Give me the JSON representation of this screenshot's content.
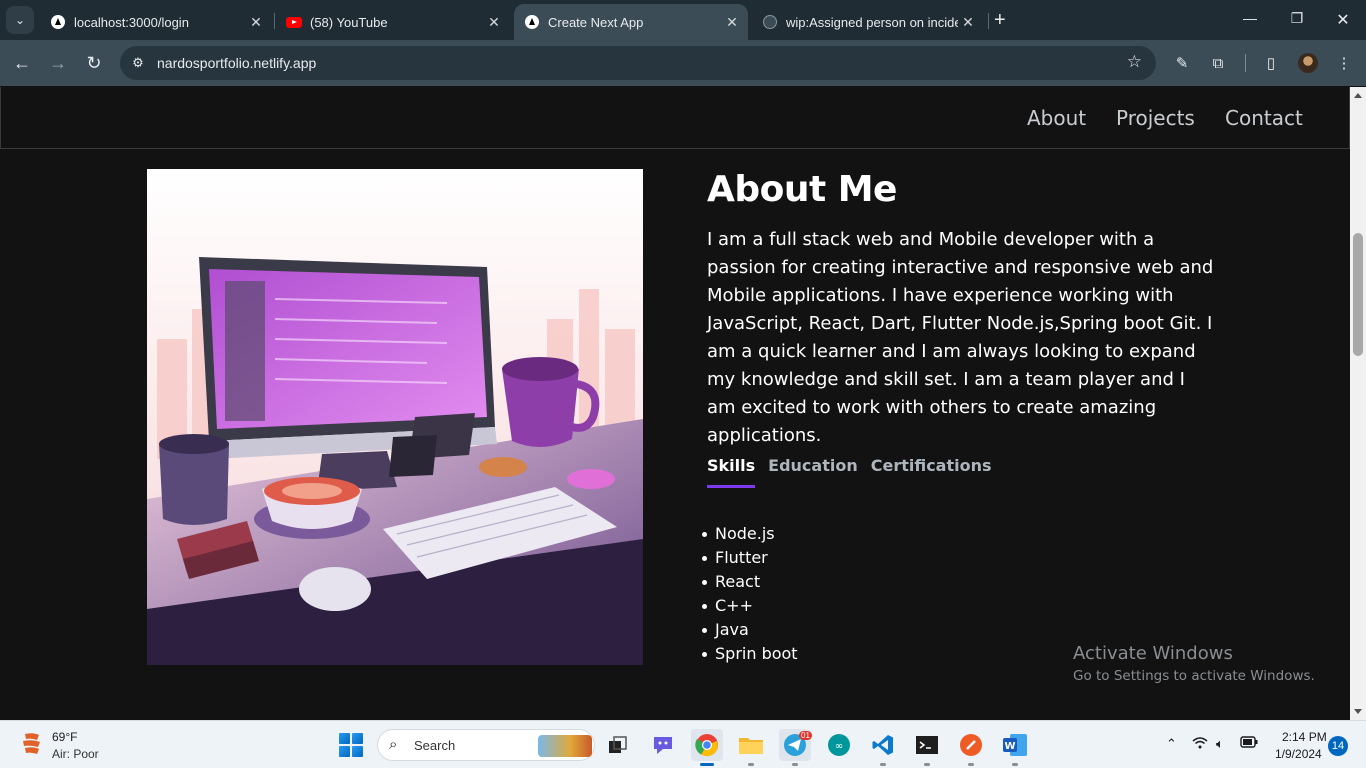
{
  "browser": {
    "tabs": [
      {
        "title": "localhost:3000/login",
        "favicon": "nextjs-icon",
        "active": false
      },
      {
        "title": "(58) YouTube",
        "favicon": "youtube-icon",
        "active": false
      },
      {
        "title": "Create Next App",
        "favicon": "nextjs-icon",
        "active": true
      },
      {
        "title": "wip:Assigned person on inciden",
        "favicon": "github-icon",
        "active": false
      }
    ],
    "url": "nardosportfolio.netlify.app"
  },
  "site": {
    "nav": {
      "about": "About",
      "projects": "Projects",
      "contact": "Contact"
    },
    "about": {
      "title": "About Me",
      "text": "I am a full stack web and Mobile developer with a passion for creating interactive and responsive web and Mobile applications. I have experience working with JavaScript, React, Dart, Flutter Node.js,Spring boot Git. I am a quick learner and I am always looking to expand my knowledge and skill set. I am a team player and I am excited to work with others to create amazing applications.",
      "tabs": [
        "Skills",
        "Education",
        "Certifications"
      ],
      "active_tab": "Skills",
      "skills": [
        "Node.js",
        "Flutter",
        "React",
        "C++",
        "Java",
        "Sprin boot"
      ]
    },
    "accent_color": "#7c3aed"
  },
  "watermark": {
    "line1": "Activate Windows",
    "line2": "Go to Settings to activate Windows."
  },
  "taskbar": {
    "weather": {
      "temp": "69°F",
      "desc": "Air: Poor"
    },
    "search_label": "Search",
    "telegram_badge": "01",
    "clock": {
      "time": "2:14 PM",
      "date": "1/9/2024"
    },
    "notifications": "14"
  }
}
